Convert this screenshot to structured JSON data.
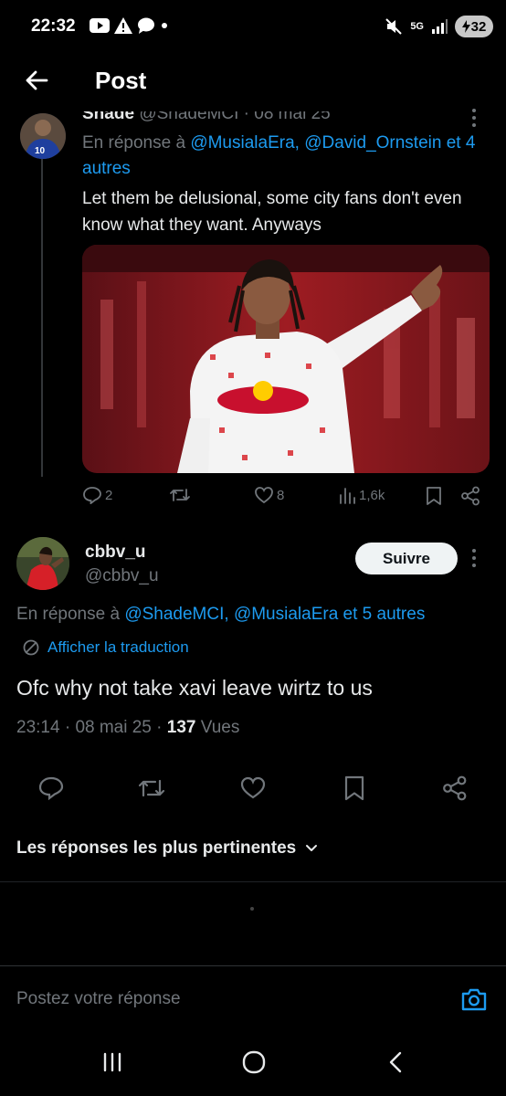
{
  "status_bar": {
    "time": "22:32",
    "network": "5G",
    "battery": "32",
    "icons": [
      "youtube-icon",
      "warning-icon",
      "chat-bubble-icon",
      "dot-icon",
      "mute-icon",
      "signal-icon",
      "battery-charging-icon"
    ]
  },
  "header": {
    "title": "Post",
    "back_icon": "arrow-left-icon"
  },
  "parent_tweet": {
    "name": "Shade",
    "handle": "@ShadeMCI",
    "date": "08 mai 25",
    "reply_prefix": "En réponse à",
    "mention_1": "@MusialaEra,",
    "mention_2": "@David_Ornstein",
    "mention_more": "et 4 autres",
    "text": "Let them be delusional, some city fans don't even know what they want. Anyways",
    "stats": {
      "replies": "2",
      "retweets": "",
      "likes": "8",
      "views": "1,6k"
    }
  },
  "main_tweet": {
    "name": "cbbv_u",
    "handle": "@cbbv_u",
    "follow_label": "Suivre",
    "reply_prefix": "En réponse à",
    "mention_1": "@ShadeMCI,",
    "mention_2": "@MusialaEra",
    "mention_more": "et 5 autres",
    "translate_label": "Afficher la traduction",
    "text": "Ofc why not take xavi leave wirtz to us",
    "time": "23:14",
    "date": "08 mai 25",
    "views_count": "137",
    "views_label": "Vues"
  },
  "replies_sort": {
    "label": "Les réponses les plus pertinentes"
  },
  "composer": {
    "placeholder": "Postez votre réponse"
  },
  "colors": {
    "accent": "#1d9bf0",
    "text_primary": "#e7e9ea",
    "text_secondary": "#71767b",
    "background": "#000000",
    "divider": "#2f3336"
  }
}
